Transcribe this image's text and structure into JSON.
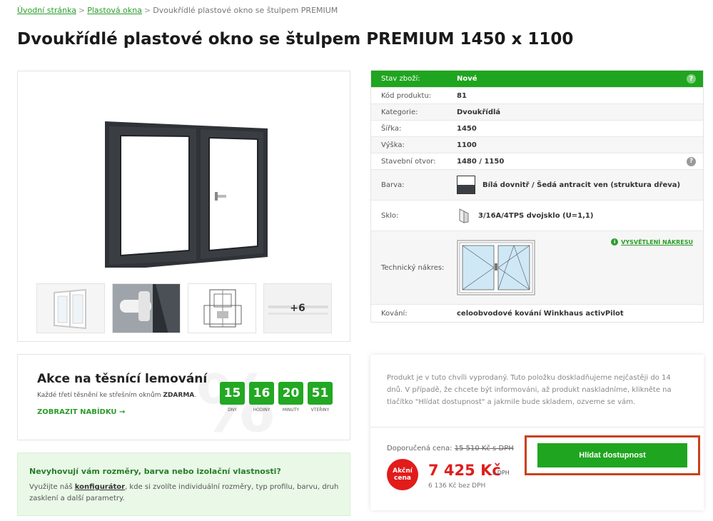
{
  "breadcrumb": {
    "home": "Úvodní stránka",
    "sep": ">",
    "category": "Plastová okna",
    "current": "Dvoukřídlé plastové okno se štulpem PREMIUM"
  },
  "page_title": "Dvoukřídlé plastové okno se štulpem PREMIUM 1450 x 1100",
  "gallery": {
    "more_label": "+6"
  },
  "spec": {
    "rows": [
      {
        "label": "Stav zboží:",
        "value": "Nové"
      },
      {
        "label": "Kód produktu:",
        "value": "81"
      },
      {
        "label": "Kategorie:",
        "value": "Dvoukřídlá"
      },
      {
        "label": "Šířka:",
        "value": "1450"
      },
      {
        "label": "Výška:",
        "value": "1100"
      },
      {
        "label": "Stavební otvor:",
        "value": "1480 / 1150"
      },
      {
        "label": "Barva:",
        "value": "Bílá dovnitř / Šedá antracit ven (struktura dřeva)"
      },
      {
        "label": "Sklo:",
        "value": "3/16A/4TPS dvojsklo (U=1,1)"
      },
      {
        "label": "Technický nákres:",
        "value": ""
      },
      {
        "label": "Kování:",
        "value": "celoobvodové kování Winkhaus activPilot"
      }
    ],
    "help_glyph": "?",
    "tech_link": "VYSVĚTLENÍ NÁKRESU",
    "info_glyph": "i"
  },
  "promo": {
    "title": "Akce na těsnící lemování",
    "text_before": "Každé třetí těsnění ke střešním oknům ",
    "text_bold": "ZDARMA",
    "text_after": ".",
    "link": "ZOBRAZIT NABÍDKU →",
    "watermark": "%",
    "countdown": [
      {
        "value": "15",
        "label": "DNY"
      },
      {
        "value": "16",
        "label": "HODINY"
      },
      {
        "value": "20",
        "label": "MINUTY"
      },
      {
        "value": "51",
        "label": "VTEŘINY"
      }
    ]
  },
  "config": {
    "title": "Nevyhovují vám rozměry, barva nebo izolační vlastnosti?",
    "text_before": "Využijte náš ",
    "link": "konfigurátor",
    "text_after": ", kde si zvolíte individuální rozměry, typ profilu, barvu, druh zasklení a další parametry."
  },
  "buybox": {
    "availability": "Produkt je v tuto chvíli vyprodaný. Tuto položku doskladňujeme nejčastěji do 14 dnů. V případě, že chcete být informováni, až produkt naskladníme, klikněte na tlačítko \"Hlídat dostupnost\" a jakmile bude skladem, ozveme se vám.",
    "price_label": "Doporučená cena:",
    "price_old": "15 510 Kč s DPH",
    "badge": "Akční cena",
    "price": "7 425 Kč",
    "price_suffix": "s DPH",
    "price_net": "6 136 Kč bez DPH",
    "notify_button": "Hlídat dostupnost"
  },
  "colors": {
    "accent": "#1fa51f",
    "sale": "#e01e1e",
    "highlight_border": "#c8421b"
  }
}
